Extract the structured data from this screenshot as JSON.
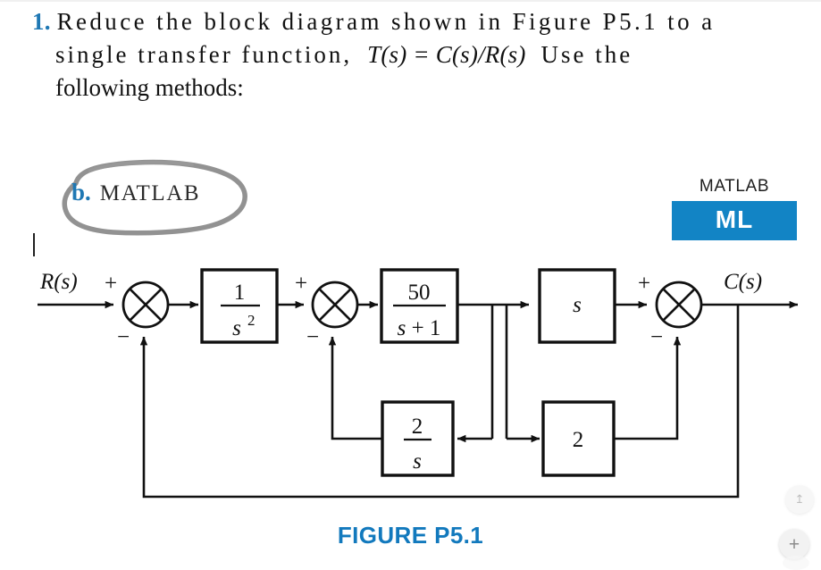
{
  "document": {
    "problem_number": "1.",
    "statement_line1": "Reduce  the  block  diagram  shown  in  Figure  P5.1  to  a",
    "statement_line2_pre": "single   transfer   function,",
    "statement_line2_math": "T(s) = C(s)/R(s)",
    "statement_line2_post": "Use   the",
    "statement_line3": "following methods:",
    "figure_caption": "FIGURE P5.1"
  },
  "annotation": {
    "item_letter": "b.",
    "item_label": "MATLAB",
    "circle_color": "#8c8c8c"
  },
  "badge": {
    "caption": "MATLAB",
    "label": "ML",
    "background": "#1284c5",
    "text_color": "#ffffff"
  },
  "colors": {
    "accent_blue": "#1f78b4",
    "caption_blue": "#1279bd",
    "ink": "#111111"
  },
  "diagram": {
    "input_label": "R(s)",
    "output_label": "C(s)",
    "blocks": [
      {
        "id": "block-1-over-s2",
        "numerator": "1",
        "denominator": "s²",
        "kind": "fraction"
      },
      {
        "id": "block-50-over-s-plus-1",
        "numerator": "50",
        "denominator": "s + 1",
        "kind": "fraction"
      },
      {
        "id": "block-s",
        "label": "s",
        "kind": "plain"
      },
      {
        "id": "block-2-over-s",
        "numerator": "2",
        "denominator": "s",
        "kind": "fraction"
      },
      {
        "id": "block-2",
        "label": "2",
        "kind": "plain"
      }
    ],
    "summing_junctions": [
      {
        "id": "sum-1",
        "positive_sign": "+",
        "negative_sign": "−"
      },
      {
        "id": "sum-2",
        "positive_sign": "+",
        "negative_sign": "−"
      },
      {
        "id": "sum-3",
        "positive_sign": "+",
        "negative_sign": "−"
      }
    ]
  },
  "controls": {
    "scroll_button_label": "↥",
    "zoom_in_button_label": "+"
  }
}
